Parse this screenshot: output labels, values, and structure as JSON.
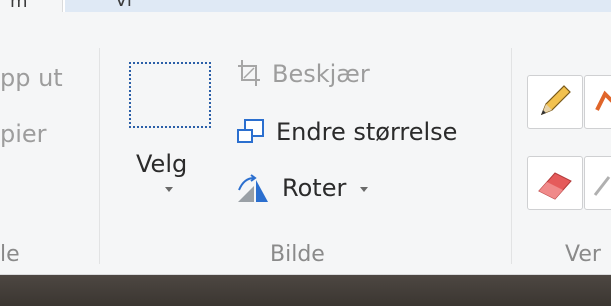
{
  "tabs": {
    "active_label": "m",
    "other_label": "Vi"
  },
  "clipboard_group": {
    "cut_label": "pp ut",
    "copy_label": "pier",
    "group_label": "le"
  },
  "image_group": {
    "select_label": "Velg",
    "crop_label": "Beskjær",
    "resize_label": "Endre størrelse",
    "rotate_label": "Roter",
    "group_label": "Bilde"
  },
  "tools_group": {
    "group_label": "Ver"
  },
  "colors": {
    "accent": "#2b6fcf",
    "ribbon_bg": "#f5f6f7"
  }
}
